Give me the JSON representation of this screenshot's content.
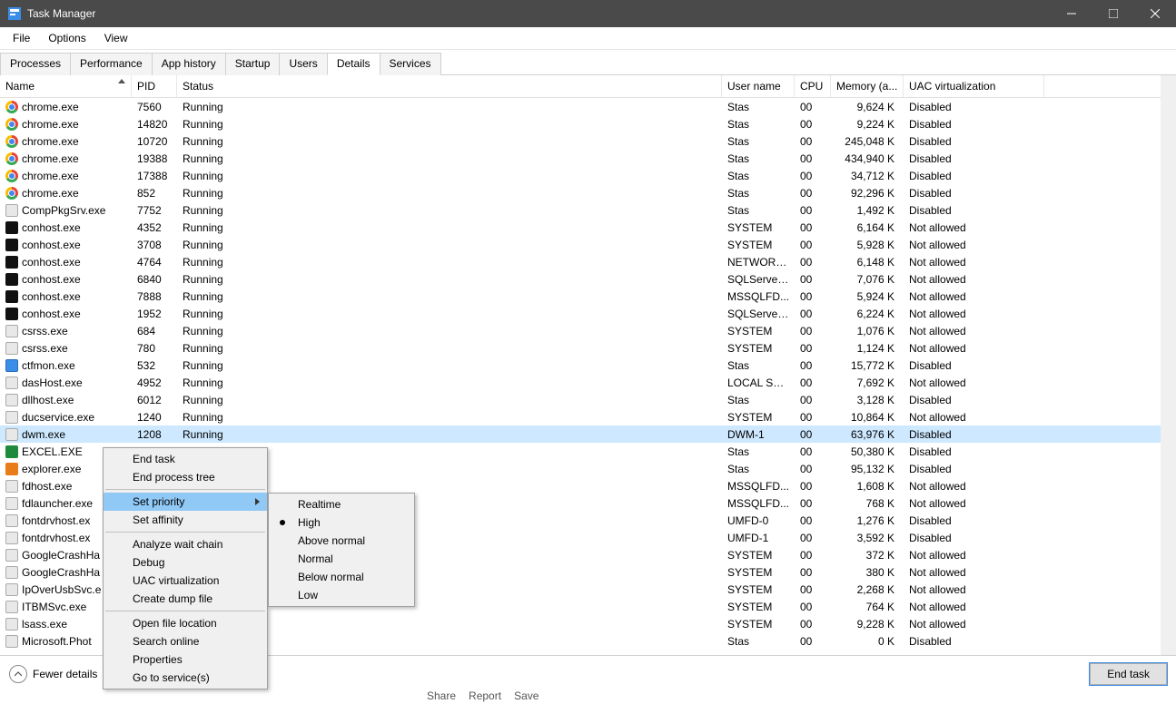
{
  "window": {
    "title": "Task Manager"
  },
  "menubar": [
    "File",
    "Options",
    "View"
  ],
  "tabs": [
    {
      "label": "Processes",
      "active": false
    },
    {
      "label": "Performance",
      "active": false
    },
    {
      "label": "App history",
      "active": false
    },
    {
      "label": "Startup",
      "active": false
    },
    {
      "label": "Users",
      "active": false
    },
    {
      "label": "Details",
      "active": true
    },
    {
      "label": "Services",
      "active": false
    }
  ],
  "columns": [
    "Name",
    "PID",
    "Status",
    "User name",
    "CPU",
    "Memory (a...",
    "UAC virtualization"
  ],
  "rows": [
    {
      "icon": "chrome",
      "name": "chrome.exe",
      "pid": "7560",
      "status": "Running",
      "user": "Stas",
      "cpu": "00",
      "mem": "9,624 K",
      "uac": "Disabled",
      "selected": false
    },
    {
      "icon": "chrome",
      "name": "chrome.exe",
      "pid": "14820",
      "status": "Running",
      "user": "Stas",
      "cpu": "00",
      "mem": "9,224 K",
      "uac": "Disabled",
      "selected": false
    },
    {
      "icon": "chrome",
      "name": "chrome.exe",
      "pid": "10720",
      "status": "Running",
      "user": "Stas",
      "cpu": "00",
      "mem": "245,048 K",
      "uac": "Disabled",
      "selected": false
    },
    {
      "icon": "chrome",
      "name": "chrome.exe",
      "pid": "19388",
      "status": "Running",
      "user": "Stas",
      "cpu": "00",
      "mem": "434,940 K",
      "uac": "Disabled",
      "selected": false
    },
    {
      "icon": "chrome",
      "name": "chrome.exe",
      "pid": "17388",
      "status": "Running",
      "user": "Stas",
      "cpu": "00",
      "mem": "34,712 K",
      "uac": "Disabled",
      "selected": false
    },
    {
      "icon": "chrome",
      "name": "chrome.exe",
      "pid": "852",
      "status": "Running",
      "user": "Stas",
      "cpu": "00",
      "mem": "92,296 K",
      "uac": "Disabled",
      "selected": false
    },
    {
      "icon": "generic",
      "name": "CompPkgSrv.exe",
      "pid": "7752",
      "status": "Running",
      "user": "Stas",
      "cpu": "00",
      "mem": "1,492 K",
      "uac": "Disabled",
      "selected": false
    },
    {
      "icon": "cmd",
      "name": "conhost.exe",
      "pid": "4352",
      "status": "Running",
      "user": "SYSTEM",
      "cpu": "00",
      "mem": "6,164 K",
      "uac": "Not allowed",
      "selected": false
    },
    {
      "icon": "cmd",
      "name": "conhost.exe",
      "pid": "3708",
      "status": "Running",
      "user": "SYSTEM",
      "cpu": "00",
      "mem": "5,928 K",
      "uac": "Not allowed",
      "selected": false
    },
    {
      "icon": "cmd",
      "name": "conhost.exe",
      "pid": "4764",
      "status": "Running",
      "user": "NETWORK...",
      "cpu": "00",
      "mem": "6,148 K",
      "uac": "Not allowed",
      "selected": false
    },
    {
      "icon": "cmd",
      "name": "conhost.exe",
      "pid": "6840",
      "status": "Running",
      "user": "SQLServer...",
      "cpu": "00",
      "mem": "7,076 K",
      "uac": "Not allowed",
      "selected": false
    },
    {
      "icon": "cmd",
      "name": "conhost.exe",
      "pid": "7888",
      "status": "Running",
      "user": "MSSQLFD...",
      "cpu": "00",
      "mem": "5,924 K",
      "uac": "Not allowed",
      "selected": false
    },
    {
      "icon": "cmd",
      "name": "conhost.exe",
      "pid": "1952",
      "status": "Running",
      "user": "SQLServer...",
      "cpu": "00",
      "mem": "6,224 K",
      "uac": "Not allowed",
      "selected": false
    },
    {
      "icon": "generic",
      "name": "csrss.exe",
      "pid": "684",
      "status": "Running",
      "user": "SYSTEM",
      "cpu": "00",
      "mem": "1,076 K",
      "uac": "Not allowed",
      "selected": false
    },
    {
      "icon": "generic",
      "name": "csrss.exe",
      "pid": "780",
      "status": "Running",
      "user": "SYSTEM",
      "cpu": "00",
      "mem": "1,124 K",
      "uac": "Not allowed",
      "selected": false
    },
    {
      "icon": "blue",
      "name": "ctfmon.exe",
      "pid": "532",
      "status": "Running",
      "user": "Stas",
      "cpu": "00",
      "mem": "15,772 K",
      "uac": "Disabled",
      "selected": false
    },
    {
      "icon": "generic",
      "name": "dasHost.exe",
      "pid": "4952",
      "status": "Running",
      "user": "LOCAL SE...",
      "cpu": "00",
      "mem": "7,692 K",
      "uac": "Not allowed",
      "selected": false
    },
    {
      "icon": "generic",
      "name": "dllhost.exe",
      "pid": "6012",
      "status": "Running",
      "user": "Stas",
      "cpu": "00",
      "mem": "3,128 K",
      "uac": "Disabled",
      "selected": false
    },
    {
      "icon": "generic",
      "name": "ducservice.exe",
      "pid": "1240",
      "status": "Running",
      "user": "SYSTEM",
      "cpu": "00",
      "mem": "10,864 K",
      "uac": "Not allowed",
      "selected": false
    },
    {
      "icon": "generic",
      "name": "dwm.exe",
      "pid": "1208",
      "status": "Running",
      "user": "DWM-1",
      "cpu": "00",
      "mem": "63,976 K",
      "uac": "Disabled",
      "selected": true
    },
    {
      "icon": "green",
      "name": "EXCEL.EXE",
      "pid": "",
      "status": "",
      "user": "Stas",
      "cpu": "00",
      "mem": "50,380 K",
      "uac": "Disabled",
      "selected": false
    },
    {
      "icon": "orange",
      "name": "explorer.exe",
      "pid": "",
      "status": "",
      "user": "Stas",
      "cpu": "00",
      "mem": "95,132 K",
      "uac": "Disabled",
      "selected": false
    },
    {
      "icon": "generic",
      "name": "fdhost.exe",
      "pid": "",
      "status": "",
      "user": "MSSQLFD...",
      "cpu": "00",
      "mem": "1,608 K",
      "uac": "Not allowed",
      "selected": false
    },
    {
      "icon": "generic",
      "name": "fdlauncher.exe",
      "pid": "",
      "status": "",
      "user": "MSSQLFD...",
      "cpu": "00",
      "mem": "768 K",
      "uac": "Not allowed",
      "selected": false
    },
    {
      "icon": "generic",
      "name": "fontdrvhost.ex",
      "pid": "",
      "status": "",
      "user": "UMFD-0",
      "cpu": "00",
      "mem": "1,276 K",
      "uac": "Disabled",
      "selected": false
    },
    {
      "icon": "generic",
      "name": "fontdrvhost.ex",
      "pid": "",
      "status": "",
      "user": "UMFD-1",
      "cpu": "00",
      "mem": "3,592 K",
      "uac": "Disabled",
      "selected": false
    },
    {
      "icon": "generic",
      "name": "GoogleCrashHa",
      "pid": "",
      "status": "",
      "user": "SYSTEM",
      "cpu": "00",
      "mem": "372 K",
      "uac": "Not allowed",
      "selected": false
    },
    {
      "icon": "generic",
      "name": "GoogleCrashHa",
      "pid": "",
      "status": "",
      "user": "SYSTEM",
      "cpu": "00",
      "mem": "380 K",
      "uac": "Not allowed",
      "selected": false
    },
    {
      "icon": "generic",
      "name": "IpOverUsbSvc.e",
      "pid": "",
      "status": "",
      "user": "SYSTEM",
      "cpu": "00",
      "mem": "2,268 K",
      "uac": "Not allowed",
      "selected": false
    },
    {
      "icon": "generic",
      "name": "ITBMSvc.exe",
      "pid": "",
      "status": "",
      "user": "SYSTEM",
      "cpu": "00",
      "mem": "764 K",
      "uac": "Not allowed",
      "selected": false
    },
    {
      "icon": "generic",
      "name": "lsass.exe",
      "pid": "",
      "status": "",
      "user": "SYSTEM",
      "cpu": "00",
      "mem": "9,228 K",
      "uac": "Not allowed",
      "selected": false
    },
    {
      "icon": "generic",
      "name": "Microsoft.Phot",
      "pid": "",
      "status": "",
      "user": "Stas",
      "cpu": "00",
      "mem": "0 K",
      "uac": "Disabled",
      "selected": false
    }
  ],
  "context_menu": {
    "items": [
      {
        "label": "End task",
        "type": "item"
      },
      {
        "label": "End process tree",
        "type": "item"
      },
      {
        "type": "sep"
      },
      {
        "label": "Set priority",
        "type": "submenu",
        "hover": true
      },
      {
        "label": "Set affinity",
        "type": "item"
      },
      {
        "type": "sep"
      },
      {
        "label": "Analyze wait chain",
        "type": "item"
      },
      {
        "label": "Debug",
        "type": "item"
      },
      {
        "label": "UAC virtualization",
        "type": "item"
      },
      {
        "label": "Create dump file",
        "type": "item"
      },
      {
        "type": "sep"
      },
      {
        "label": "Open file location",
        "type": "item"
      },
      {
        "label": "Search online",
        "type": "item"
      },
      {
        "label": "Properties",
        "type": "item"
      },
      {
        "label": "Go to service(s)",
        "type": "item"
      }
    ],
    "submenu": [
      {
        "label": "Realtime",
        "checked": false
      },
      {
        "label": "High",
        "checked": true
      },
      {
        "label": "Above normal",
        "checked": false
      },
      {
        "label": "Normal",
        "checked": false
      },
      {
        "label": "Below normal",
        "checked": false
      },
      {
        "label": "Low",
        "checked": false
      }
    ]
  },
  "footer": {
    "fewer_details": "Fewer details",
    "end_task": "End task"
  },
  "status_peek": [
    "Share",
    "Report",
    "Save"
  ]
}
